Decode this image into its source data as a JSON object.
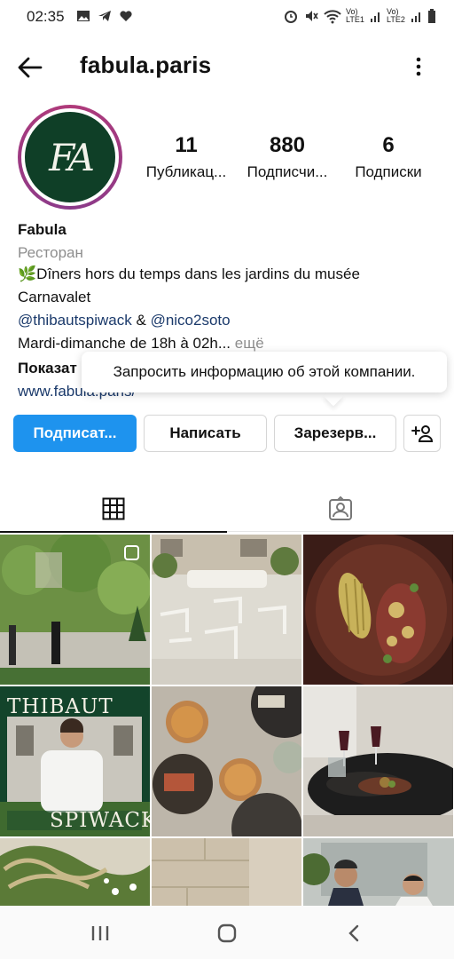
{
  "status_bar": {
    "time": "02:35",
    "sim1": "Vo) LTE1",
    "sim2": "Vo) LTE2"
  },
  "header": {
    "title": "fabula.paris"
  },
  "profile": {
    "avatar_text": "FA",
    "stats": [
      {
        "count": "11",
        "label": "Публикац..."
      },
      {
        "count": "880",
        "label": "Подписчи..."
      },
      {
        "count": "6",
        "label": "Подписки"
      }
    ],
    "name": "Fabula",
    "category": "Ресторан",
    "description": "🌿Dîners hors du temps dans les jardins du musée Carnavalet",
    "mention1": "@thibautspiwack",
    "amp": " & ",
    "mention2": "@nico2soto",
    "hours": "Mardi-dimanche de 18h à 02h...",
    "more": " ещё",
    "show_label": "Показат",
    "website": "www.fabula.paris/"
  },
  "tooltip": {
    "text": "Запросить информацию об этой компании."
  },
  "buttons": {
    "follow": "Подписат...",
    "message": "Написать",
    "book": "Зарезерв..."
  },
  "tabs": [
    {
      "icon": "grid-icon"
    },
    {
      "icon": "tagged-icon"
    }
  ],
  "grid": {
    "cells": [
      {
        "name": "post-garden-courtyard",
        "overlay": ""
      },
      {
        "name": "post-terrace-chairs",
        "overlay": ""
      },
      {
        "name": "post-plated-dish",
        "overlay": ""
      },
      {
        "name": "post-chef-portrait",
        "overlay_top": "THIBAUT",
        "overlay_bottom": "SPIWACK"
      },
      {
        "name": "post-cocktails",
        "overlay": ""
      },
      {
        "name": "post-table-setting",
        "overlay": ""
      },
      {
        "name": "post-garden-maze",
        "overlay": ""
      },
      {
        "name": "post-stone-wall",
        "overlay": ""
      },
      {
        "name": "post-two-chefs",
        "overlay": ""
      }
    ]
  },
  "colors": {
    "accent": "#1e93ee",
    "link": "#1b3a6b",
    "avatar_bg": "#0f3f27"
  }
}
